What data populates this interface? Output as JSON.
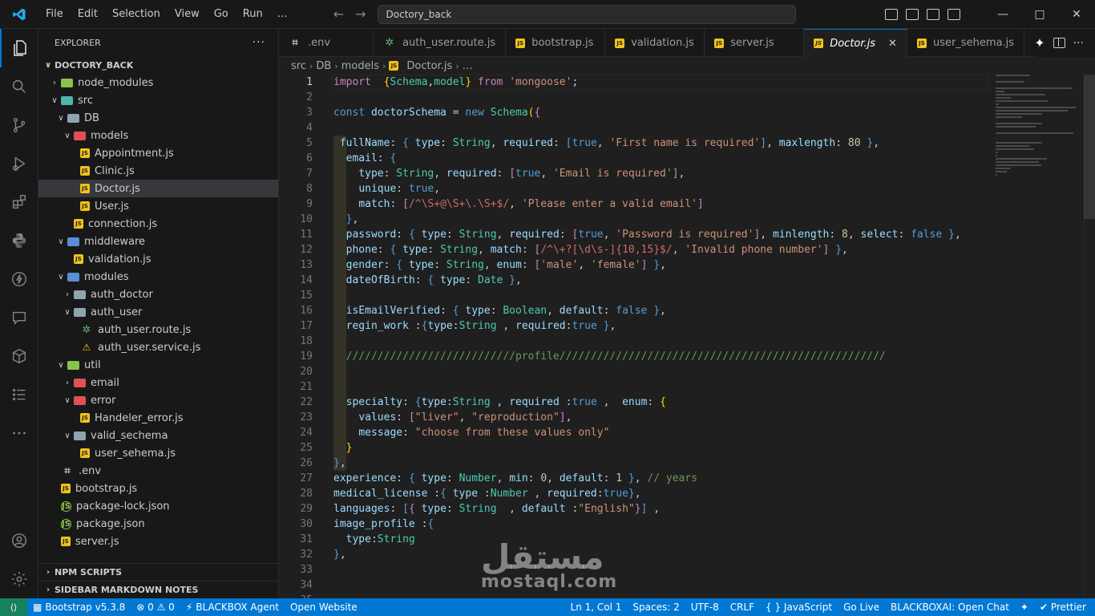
{
  "titlebar": {
    "menu": [
      "File",
      "Edit",
      "Selection",
      "View",
      "Go",
      "Run",
      "…"
    ],
    "search": "Doctory_back"
  },
  "explorer": {
    "title": "EXPLORER",
    "root": "DOCTORY_BACK",
    "tree": [
      {
        "label": "node_modules",
        "depth": 1,
        "chevron": "right",
        "icon": "folder-green"
      },
      {
        "label": "src",
        "depth": 1,
        "chevron": "down",
        "icon": "folder-teal"
      },
      {
        "label": "DB",
        "depth": 2,
        "chevron": "down",
        "icon": "folder-gray"
      },
      {
        "label": "models",
        "depth": 3,
        "chevron": "down",
        "icon": "folder-red"
      },
      {
        "label": "Appointment.js",
        "depth": 4,
        "icon": "js"
      },
      {
        "label": "Clinic.js",
        "depth": 4,
        "icon": "js"
      },
      {
        "label": "Doctor.js",
        "depth": 4,
        "icon": "js",
        "selected": true
      },
      {
        "label": "User.js",
        "depth": 4,
        "icon": "js"
      },
      {
        "label": "connection.js",
        "depth": 3,
        "icon": "js"
      },
      {
        "label": "middleware",
        "depth": 2,
        "chevron": "down",
        "icon": "folder-blue"
      },
      {
        "label": "validation.js",
        "depth": 3,
        "icon": "js"
      },
      {
        "label": "modules",
        "depth": 2,
        "chevron": "down",
        "icon": "folder-blue"
      },
      {
        "label": "auth_doctor",
        "depth": 3,
        "chevron": "right",
        "icon": "folder-gray"
      },
      {
        "label": "auth_user",
        "depth": 3,
        "chevron": "down",
        "icon": "folder-gray"
      },
      {
        "label": "auth_user.route.js",
        "depth": 4,
        "icon": "route"
      },
      {
        "label": "auth_user.service.js",
        "depth": 4,
        "icon": "service"
      },
      {
        "label": "util",
        "depth": 2,
        "chevron": "down",
        "icon": "folder-green"
      },
      {
        "label": "email",
        "depth": 3,
        "chevron": "right",
        "icon": "folder-red"
      },
      {
        "label": "error",
        "depth": 3,
        "chevron": "down",
        "icon": "folder-red"
      },
      {
        "label": "Handeler_error.js",
        "depth": 4,
        "icon": "js"
      },
      {
        "label": "valid_sechema",
        "depth": 3,
        "chevron": "down",
        "icon": "folder-gray"
      },
      {
        "label": "user_sehema.js",
        "depth": 4,
        "icon": "js"
      },
      {
        "label": ".env",
        "depth": 1,
        "icon": "env"
      },
      {
        "label": "bootstrap.js",
        "depth": 1,
        "icon": "js"
      },
      {
        "label": "package-lock.json",
        "depth": 1,
        "icon": "json"
      },
      {
        "label": "package.json",
        "depth": 1,
        "icon": "json"
      },
      {
        "label": "server.js",
        "depth": 1,
        "icon": "js"
      }
    ],
    "sections": [
      "NPM SCRIPTS",
      "SIDEBAR MARKDOWN NOTES"
    ]
  },
  "tabs": [
    {
      "label": ".env",
      "icon": "env"
    },
    {
      "label": "auth_user.route.js",
      "icon": "route"
    },
    {
      "label": "bootstrap.js",
      "icon": "js"
    },
    {
      "label": "validation.js",
      "icon": "js"
    },
    {
      "label": "server.js",
      "icon": "js"
    },
    {
      "label": "Doctor.js",
      "icon": "js",
      "active": true
    },
    {
      "label": "user_sehema.js",
      "icon": "js"
    }
  ],
  "breadcrumb": [
    "src",
    "DB",
    "models",
    "Doctor.js",
    "…"
  ],
  "code": {
    "current_line": 1,
    "lines": [
      [
        [
          "k",
          "import"
        ],
        [
          "",
          "  "
        ],
        [
          "y",
          "{"
        ],
        [
          "t",
          "Schema"
        ],
        [
          "",
          ","
        ],
        [
          "t",
          "model"
        ],
        [
          "y",
          "}"
        ],
        [
          "",
          " "
        ],
        [
          "k",
          "from"
        ],
        [
          "",
          " "
        ],
        [
          "s",
          "'mongoose'"
        ],
        [
          "",
          ";"
        ]
      ],
      [],
      [
        [
          "b",
          "const"
        ],
        [
          "",
          " "
        ],
        [
          "p",
          "doctorSchema"
        ],
        [
          "",
          " = "
        ],
        [
          "b",
          "new"
        ],
        [
          "",
          " "
        ],
        [
          "t",
          "Schema"
        ],
        [
          "y",
          "("
        ],
        [
          "k",
          "{"
        ]
      ],
      [],
      [
        [
          "",
          " "
        ],
        [
          "p",
          "fullName"
        ],
        [
          "",
          ": "
        ],
        [
          "b",
          "{"
        ],
        [
          "",
          " "
        ],
        [
          "p",
          "type"
        ],
        [
          "",
          ": "
        ],
        [
          "t",
          "String"
        ],
        [
          "",
          ", "
        ],
        [
          "p",
          "required"
        ],
        [
          "",
          ": "
        ],
        [
          "b",
          "["
        ],
        [
          "b",
          "true"
        ],
        [
          "",
          ", "
        ],
        [
          "s",
          "'First name is required'"
        ],
        [
          "b",
          "]"
        ],
        [
          "",
          ", "
        ],
        [
          "p",
          "maxlength"
        ],
        [
          "",
          ": "
        ],
        [
          "n",
          "80"
        ],
        [
          "",
          " "
        ],
        [
          "b",
          "}"
        ],
        [
          "",
          ","
        ]
      ],
      [
        [
          "",
          "  "
        ],
        [
          "p",
          "email"
        ],
        [
          "",
          ": "
        ],
        [
          "b",
          "{"
        ]
      ],
      [
        [
          "",
          "    "
        ],
        [
          "p",
          "type"
        ],
        [
          "",
          ": "
        ],
        [
          "t",
          "String"
        ],
        [
          "",
          ", "
        ],
        [
          "p",
          "required"
        ],
        [
          "",
          ": "
        ],
        [
          "k",
          "["
        ],
        [
          "b",
          "true"
        ],
        [
          "",
          ", "
        ],
        [
          "s",
          "'Email is required'"
        ],
        [
          "k",
          "]"
        ],
        [
          "",
          ","
        ]
      ],
      [
        [
          "",
          "    "
        ],
        [
          "p",
          "unique"
        ],
        [
          "",
          ": "
        ],
        [
          "b",
          "true"
        ],
        [
          "",
          ","
        ]
      ],
      [
        [
          "",
          "    "
        ],
        [
          "p",
          "match"
        ],
        [
          "",
          ": "
        ],
        [
          "k",
          "["
        ],
        [
          "r",
          "/^\\S+@\\S+\\.\\S+$/"
        ],
        [
          "",
          ", "
        ],
        [
          "s",
          "'Please enter a valid email'"
        ],
        [
          "k",
          "]"
        ]
      ],
      [
        [
          "",
          "  "
        ],
        [
          "b",
          "}"
        ],
        [
          "",
          ","
        ]
      ],
      [
        [
          "",
          "  "
        ],
        [
          "p",
          "password"
        ],
        [
          "",
          ": "
        ],
        [
          "b",
          "{"
        ],
        [
          "",
          " "
        ],
        [
          "p",
          "type"
        ],
        [
          "",
          ": "
        ],
        [
          "t",
          "String"
        ],
        [
          "",
          ", "
        ],
        [
          "p",
          "required"
        ],
        [
          "",
          ": "
        ],
        [
          "k",
          "["
        ],
        [
          "b",
          "true"
        ],
        [
          "",
          ", "
        ],
        [
          "s",
          "'Password is required'"
        ],
        [
          "k",
          "]"
        ],
        [
          "",
          ", "
        ],
        [
          "p",
          "minlength"
        ],
        [
          "",
          ": "
        ],
        [
          "n",
          "8"
        ],
        [
          "",
          ", "
        ],
        [
          "p",
          "select"
        ],
        [
          "",
          ": "
        ],
        [
          "b",
          "false"
        ],
        [
          "",
          " "
        ],
        [
          "b",
          "}"
        ],
        [
          "",
          ","
        ]
      ],
      [
        [
          "",
          "  "
        ],
        [
          "p",
          "phone"
        ],
        [
          "",
          ": "
        ],
        [
          "b",
          "{"
        ],
        [
          "",
          " "
        ],
        [
          "p",
          "type"
        ],
        [
          "",
          ": "
        ],
        [
          "t",
          "String"
        ],
        [
          "",
          ", "
        ],
        [
          "p",
          "match"
        ],
        [
          "",
          ": "
        ],
        [
          "k",
          "["
        ],
        [
          "r",
          "/^\\+?[\\d\\s-]{10,15}$/"
        ],
        [
          "",
          ", "
        ],
        [
          "s",
          "'Invalid phone number'"
        ],
        [
          "k",
          "]"
        ],
        [
          "",
          " "
        ],
        [
          "b",
          "}"
        ],
        [
          "",
          ","
        ]
      ],
      [
        [
          "",
          "  "
        ],
        [
          "p",
          "gender"
        ],
        [
          "",
          ": "
        ],
        [
          "b",
          "{"
        ],
        [
          "",
          " "
        ],
        [
          "p",
          "type"
        ],
        [
          "",
          ": "
        ],
        [
          "t",
          "String"
        ],
        [
          "",
          ", "
        ],
        [
          "p",
          "enum"
        ],
        [
          "",
          ": "
        ],
        [
          "k",
          "["
        ],
        [
          "s",
          "'male'"
        ],
        [
          "",
          ", "
        ],
        [
          "s",
          "'female'"
        ],
        [
          "k",
          "]"
        ],
        [
          "",
          " "
        ],
        [
          "b",
          "}"
        ],
        [
          "",
          ","
        ]
      ],
      [
        [
          "",
          "  "
        ],
        [
          "p",
          "dateOfBirth"
        ],
        [
          "",
          ": "
        ],
        [
          "b",
          "{"
        ],
        [
          "",
          " "
        ],
        [
          "p",
          "type"
        ],
        [
          "",
          ": "
        ],
        [
          "t",
          "Date"
        ],
        [
          "",
          " "
        ],
        [
          "b",
          "}"
        ],
        [
          "",
          ","
        ]
      ],
      [],
      [
        [
          "",
          "  "
        ],
        [
          "p",
          "isEmailVerified"
        ],
        [
          "",
          ": "
        ],
        [
          "b",
          "{"
        ],
        [
          "",
          " "
        ],
        [
          "p",
          "type"
        ],
        [
          "",
          ": "
        ],
        [
          "t",
          "Boolean"
        ],
        [
          "",
          ", "
        ],
        [
          "p",
          "default"
        ],
        [
          "",
          ": "
        ],
        [
          "b",
          "false"
        ],
        [
          "",
          " "
        ],
        [
          "b",
          "}"
        ],
        [
          "",
          ","
        ]
      ],
      [
        [
          "",
          "  "
        ],
        [
          "p",
          "regin_work"
        ],
        [
          "",
          " :"
        ],
        [
          "b",
          "{"
        ],
        [
          "p",
          "type"
        ],
        [
          "",
          ":"
        ],
        [
          "t",
          "String"
        ],
        [
          "",
          " , "
        ],
        [
          "p",
          "required"
        ],
        [
          "",
          ":"
        ],
        [
          "b",
          "true"
        ],
        [
          "",
          " "
        ],
        [
          "b",
          "}"
        ],
        [
          "",
          ","
        ]
      ],
      [],
      [
        [
          "",
          "  "
        ],
        [
          "c",
          "///////////////////////////profile////////////////////////////////////////////////////"
        ]
      ],
      [],
      [],
      [
        [
          "",
          "  "
        ],
        [
          "p",
          "specialty"
        ],
        [
          "",
          ": "
        ],
        [
          "b",
          "{"
        ],
        [
          "p",
          "type"
        ],
        [
          "",
          ":"
        ],
        [
          "t",
          "String"
        ],
        [
          "",
          " , "
        ],
        [
          "p",
          "required"
        ],
        [
          "",
          " :"
        ],
        [
          "b",
          "true"
        ],
        [
          "",
          " ,  "
        ],
        [
          "p",
          "enum"
        ],
        [
          "",
          ": "
        ],
        [
          "y",
          "{"
        ]
      ],
      [
        [
          "",
          "    "
        ],
        [
          "p",
          "values"
        ],
        [
          "",
          ": "
        ],
        [
          "k",
          "["
        ],
        [
          "s",
          "\"liver\""
        ],
        [
          "",
          ", "
        ],
        [
          "s",
          "\"reproduction\""
        ],
        [
          "k",
          "]"
        ],
        [
          "",
          ","
        ]
      ],
      [
        [
          "",
          "    "
        ],
        [
          "p",
          "message"
        ],
        [
          "",
          ": "
        ],
        [
          "s",
          "\"choose from these values only\""
        ]
      ],
      [
        [
          "",
          "  "
        ],
        [
          "y",
          "}"
        ]
      ],
      [
        [
          "b",
          "}"
        ],
        [
          "",
          ","
        ]
      ],
      [
        [
          "p",
          "experience"
        ],
        [
          "",
          ": "
        ],
        [
          "b",
          "{"
        ],
        [
          "",
          " "
        ],
        [
          "p",
          "type"
        ],
        [
          "",
          ": "
        ],
        [
          "t",
          "Number"
        ],
        [
          "",
          ", "
        ],
        [
          "p",
          "min"
        ],
        [
          "",
          ": "
        ],
        [
          "n",
          "0"
        ],
        [
          "",
          ", "
        ],
        [
          "p",
          "default"
        ],
        [
          "",
          ": "
        ],
        [
          "n",
          "1"
        ],
        [
          "",
          " "
        ],
        [
          "b",
          "}"
        ],
        [
          "",
          ", "
        ],
        [
          "c",
          "// years"
        ]
      ],
      [
        [
          "p",
          "medical_license"
        ],
        [
          "",
          " :"
        ],
        [
          "b",
          "{"
        ],
        [
          "",
          " "
        ],
        [
          "p",
          "type"
        ],
        [
          "",
          " :"
        ],
        [
          "t",
          "Number"
        ],
        [
          "",
          " , "
        ],
        [
          "p",
          "required"
        ],
        [
          "",
          ":"
        ],
        [
          "b",
          "true"
        ],
        [
          "b",
          "}"
        ],
        [
          "",
          ","
        ]
      ],
      [
        [
          "p",
          "languages"
        ],
        [
          "",
          ": "
        ],
        [
          "b",
          "["
        ],
        [
          "k",
          "{"
        ],
        [
          "",
          " "
        ],
        [
          "p",
          "type"
        ],
        [
          "",
          ": "
        ],
        [
          "t",
          "String"
        ],
        [
          "",
          "  , "
        ],
        [
          "p",
          "default"
        ],
        [
          "",
          " :"
        ],
        [
          "s",
          "\"English\""
        ],
        [
          "k",
          "}"
        ],
        [
          "b",
          "]"
        ],
        [
          "",
          " ,"
        ]
      ],
      [
        [
          "p",
          "image_profile"
        ],
        [
          "",
          " :"
        ],
        [
          "b",
          "{"
        ]
      ],
      [
        [
          "",
          "  "
        ],
        [
          "p",
          "type"
        ],
        [
          "",
          ":"
        ],
        [
          "t",
          "String"
        ]
      ],
      [
        [
          "b",
          "}"
        ],
        [
          "",
          ","
        ]
      ],
      [],
      [],
      []
    ]
  },
  "watermark": {
    "arabic": "مستقل",
    "latin": "mostaql.com"
  },
  "statusbar": {
    "left": [
      "Bootstrap v5.3.8",
      "⊗ 0 ⚠ 0",
      "BLACKBOX Agent",
      "Open Website"
    ],
    "right": [
      "Ln 1, Col 1",
      "Spaces: 2",
      "UTF-8",
      "CRLF",
      "{ } JavaScript",
      "Go Live",
      "BLACKBOXAI: Open Chat",
      "✦",
      "✔ Prettier"
    ]
  }
}
